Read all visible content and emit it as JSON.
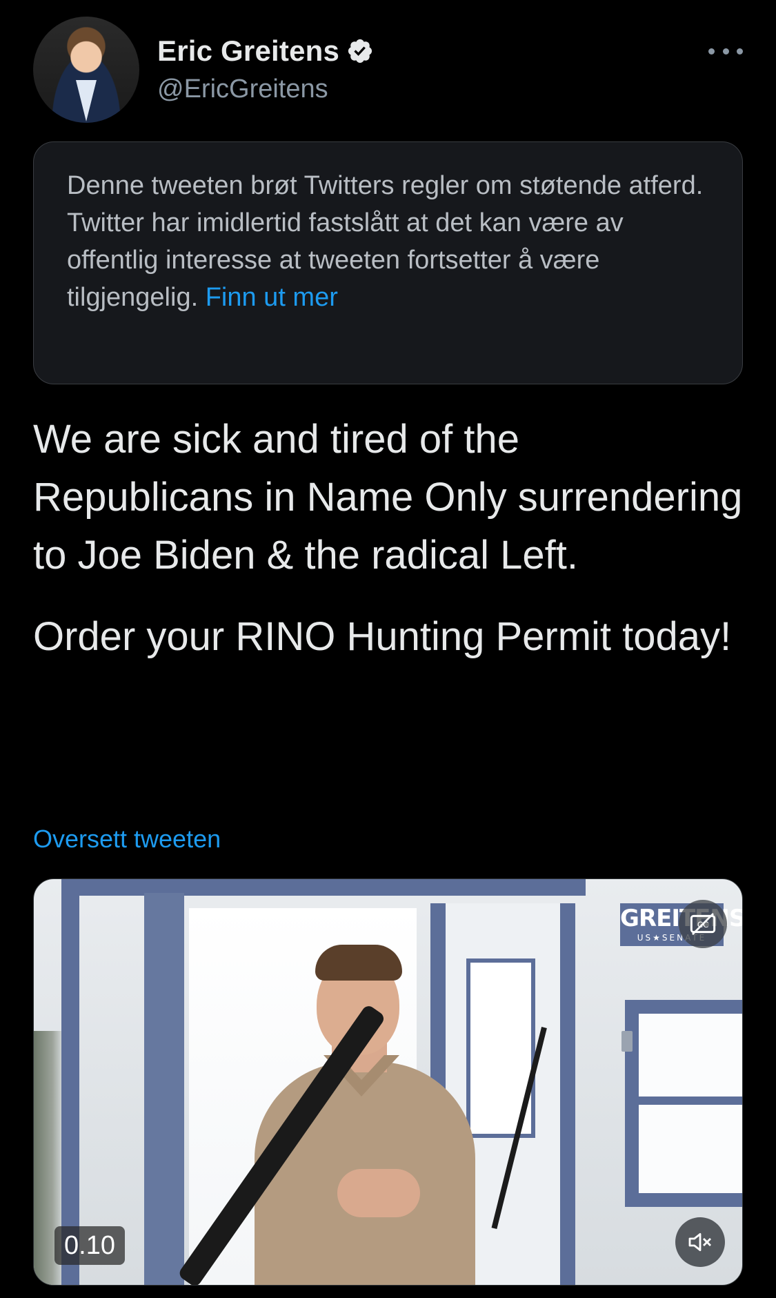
{
  "author": {
    "name": "Eric Greitens",
    "handle": "@EricGreitens",
    "verified": true
  },
  "notice": {
    "text": "Denne tweeten brøt Twitters regler om støtende atferd. Twitter har imidlertid fastslått at det kan være av offentlig interesse at tweeten fortsetter å være tilgjengelig.",
    "link_label": "Finn ut mer"
  },
  "tweet": {
    "paragraphs": [
      "We are sick and tired of the Republicans in Name Only surrendering to Joe Biden & the radical Left.",
      "Order your RINO Hunting Permit today!"
    ],
    "translate_label": "Oversett tweeten"
  },
  "video": {
    "logo_main": "GREITENS",
    "logo_sub": "US★SENATE",
    "time": "0.10",
    "captions_icon": "cc-icon",
    "mute_icon": "muted-speaker-icon"
  },
  "colors": {
    "background": "#000000",
    "accent": "#1d9bf0",
    "notice_bg": "#16181c",
    "secondary_text": "#8b98a5"
  }
}
